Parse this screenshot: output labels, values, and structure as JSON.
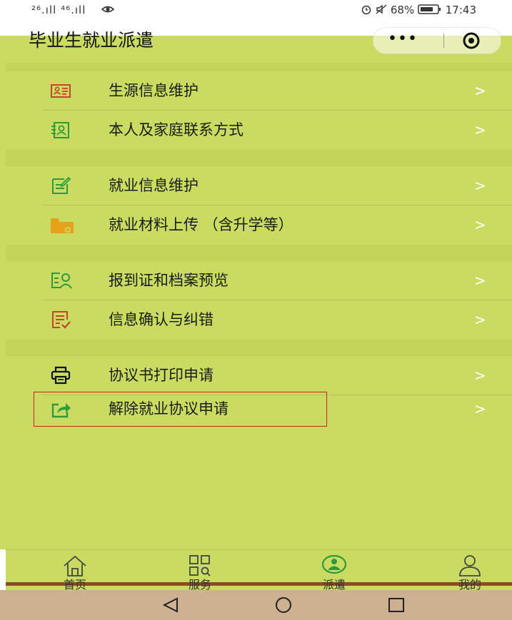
{
  "status_bar": {
    "signal_text": "²⁶.ıll ⁴⁶.ıll",
    "right_text": "68%",
    "time": "17:43"
  },
  "header": {
    "title": "毕业生就业派遣"
  },
  "menu_groups": [
    {
      "items": [
        {
          "label": "生源信息维护",
          "icon": "id-card-icon",
          "arrow": ">"
        },
        {
          "label": "本人及家庭联系方式",
          "icon": "contact-card-icon",
          "arrow": ">"
        }
      ]
    },
    {
      "items": [
        {
          "label": "就业信息维护",
          "icon": "edit-document-icon",
          "arrow": ">"
        },
        {
          "label": "就业材料上传 （含升学等）",
          "icon": "folder-upload-icon",
          "arrow": ">"
        }
      ]
    },
    {
      "items": [
        {
          "label": "报到证和档案预览",
          "icon": "person-scan-icon",
          "arrow": ">"
        },
        {
          "label": "信息确认与纠错",
          "icon": "checklist-icon",
          "arrow": ">"
        }
      ]
    },
    {
      "items": [
        {
          "label": "协议书打印申请",
          "icon": "printer-icon",
          "arrow": ">"
        },
        {
          "label": "解除就业协议申请",
          "icon": "share-out-icon",
          "arrow": ">"
        }
      ]
    }
  ],
  "tab_bar": {
    "tabs": [
      {
        "label": "首页",
        "icon": "home-icon"
      },
      {
        "label": "服务",
        "icon": "grid-search-icon"
      },
      {
        "label": "派遣",
        "icon": "dispatch-icon"
      },
      {
        "label": "我的",
        "icon": "user-icon"
      }
    ]
  },
  "colors": {
    "page_bg": "#c9dc61",
    "icon_green": "#2e9a3c",
    "icon_red": "#c8432c",
    "icon_orange": "#e5a21a",
    "arrow": "#ffffff",
    "highlight_border": "#d02020"
  }
}
